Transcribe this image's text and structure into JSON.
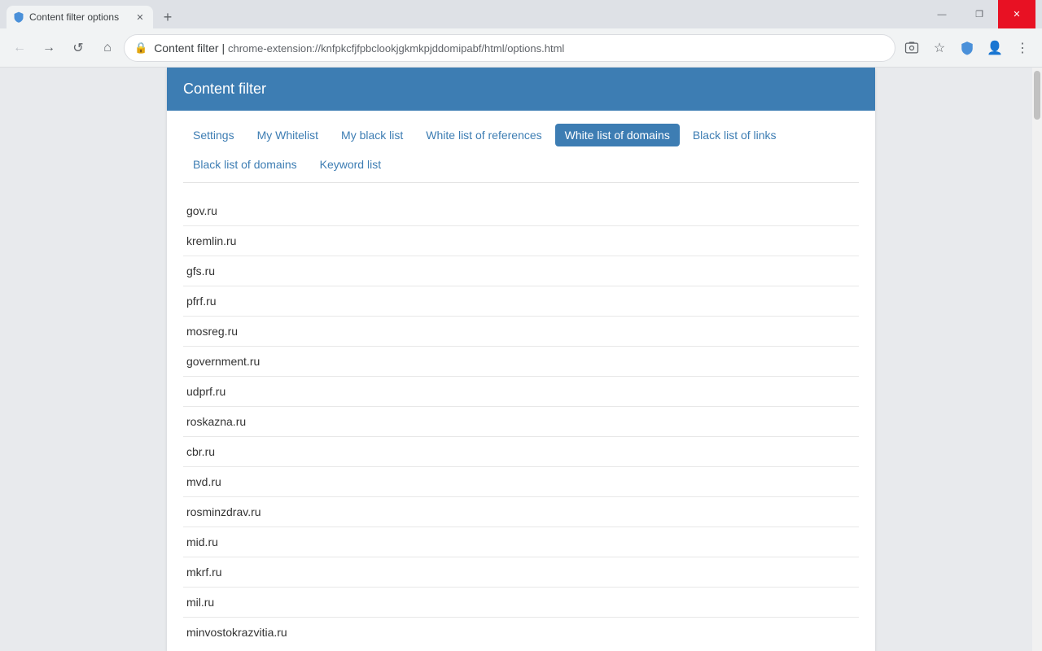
{
  "browser": {
    "tab_title": "Content filter options",
    "tab_icon": "shield",
    "new_tab_tooltip": "New tab",
    "window_controls": {
      "minimize": "—",
      "maximize": "❐",
      "close": "✕"
    }
  },
  "toolbar": {
    "back_btn": "←",
    "forward_btn": "→",
    "reload_btn": "↺",
    "home_btn": "⌂",
    "address_lock": "🔒",
    "address_breadcrumb": "Content filter",
    "address_separator": "|",
    "address_url": "chrome-extension://knfpkcfjfpbclookjgkmkpjddomipabf/html/options.html",
    "screenshot_icon": "📷",
    "star_icon": "☆",
    "shield_icon": "🛡",
    "profile_icon": "👤",
    "menu_icon": "⋮"
  },
  "page": {
    "header_title": "Content filter",
    "tabs": [
      {
        "id": "settings",
        "label": "Settings",
        "active": false
      },
      {
        "id": "my-whitelist",
        "label": "My Whitelist",
        "active": false
      },
      {
        "id": "my-black-list",
        "label": "My black list",
        "active": false
      },
      {
        "id": "white-list-references",
        "label": "White list of references",
        "active": false
      },
      {
        "id": "white-list-domains",
        "label": "White list of domains",
        "active": true
      },
      {
        "id": "black-list-links",
        "label": "Black list of links",
        "active": false
      },
      {
        "id": "black-list-domains",
        "label": "Black list of domains",
        "active": false
      },
      {
        "id": "keyword-list",
        "label": "Keyword list",
        "active": false
      }
    ],
    "domains": [
      "gov.ru",
      "kremlin.ru",
      "gfs.ru",
      "pfrf.ru",
      "mosreg.ru",
      "government.ru",
      "udprf.ru",
      "roskazna.ru",
      "cbr.ru",
      "mvd.ru",
      "rosminzdrav.ru",
      "mid.ru",
      "mkrf.ru",
      "mil.ru",
      "minvostokrazvitia.ru"
    ]
  }
}
